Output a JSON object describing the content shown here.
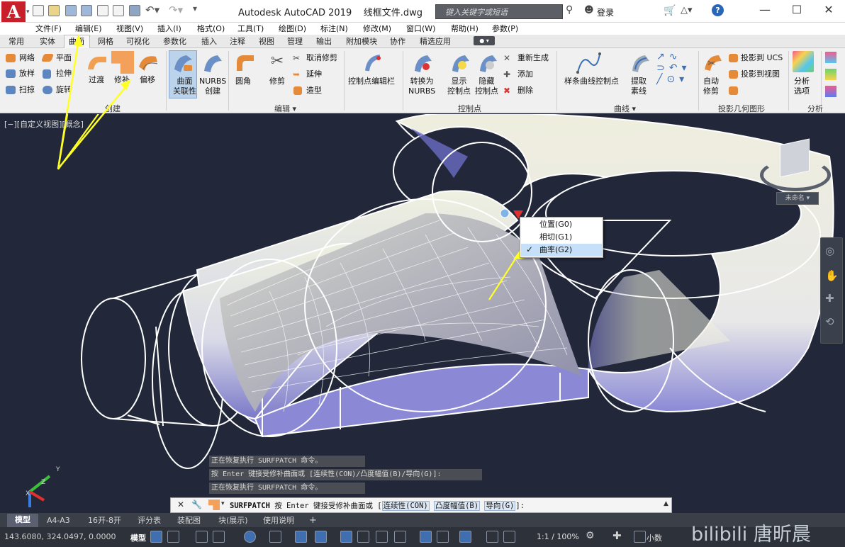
{
  "app": {
    "logo_letter": "A",
    "title": "Autodesk AutoCAD 2019",
    "file": "线框文件.dwg",
    "search_placeholder": "键入关键字或短语",
    "login_label": "登录",
    "help_label": "?"
  },
  "window_controls": {
    "minimize": "—",
    "maximize": "☐",
    "close": "✕"
  },
  "menus": [
    "文件(F)",
    "编辑(E)",
    "视图(V)",
    "插入(I)",
    "格式(O)",
    "工具(T)",
    "绘图(D)",
    "标注(N)",
    "修改(M)",
    "窗口(W)",
    "帮助(H)",
    "参数(P)"
  ],
  "ribbon_tabs": [
    "常用",
    "实体",
    "曲面",
    "网格",
    "可视化",
    "参数化",
    "插入",
    "注释",
    "视图",
    "管理",
    "输出",
    "附加模块",
    "协作",
    "精选应用"
  ],
  "active_tab": "曲面",
  "ribbon": {
    "create_small": [
      "网络",
      "放样",
      "扫掠",
      "平面",
      "拉伸",
      "旋转"
    ],
    "create_large": [
      "过渡",
      "修补",
      "偏移"
    ],
    "assoc_1": "曲面",
    "assoc_2": "关联性",
    "nurbs_1": "NURBS",
    "nurbs_2": "创建",
    "fillet": "圆角",
    "trim": "修剪",
    "edit_small": [
      "取消修剪",
      "延伸",
      "造型"
    ],
    "cv_editbar": "控制点编辑栏",
    "to_nurbs_1": "转换为",
    "to_nurbs_2": "NURBS",
    "show_cv_1": "显示",
    "show_cv_2": "控制点",
    "hide_cv_1": "隐藏",
    "hide_cv_2": "控制点",
    "cv_small": [
      "重新生成",
      "添加",
      "删除"
    ],
    "spline_cv": "样条曲线控制点",
    "extract_1": "提取",
    "extract_2": "素线",
    "auto_trim_1": "自动",
    "auto_trim_2": "修剪",
    "proj_small": [
      "投影到 UCS",
      "投影到视图"
    ],
    "analysis_1": "分析",
    "analysis_2": "选项"
  },
  "panels": [
    "创建",
    "编辑 ▾",
    "控制点",
    "曲线 ▾",
    "投影几何图形",
    "分析"
  ],
  "viewport_label": "[−][自定义视图][概念]",
  "viewcube_label": "未命名 ▾",
  "context_menu": {
    "items": [
      "位置(G0)",
      "相切(G1)",
      "曲率(G2)"
    ],
    "checked": "✓"
  },
  "command_history": [
    "正在恢复执行 SURFPATCH 命令。",
    "按 Enter 键接受修补曲面或 [连续性(CON)/凸度幅值(B)/导向(G)]:",
    "正在恢复执行 SURFPATCH 命令。"
  ],
  "command_line": {
    "cmd": "SURFPATCH",
    "text": "按 Enter 键接受修补曲面或 [",
    "opt1": "连续性(CON)",
    "opt2": "凸度幅值(B)",
    "opt3": "导向(G)",
    "end": "]:"
  },
  "layout_tabs": [
    "模型",
    "A4-A3",
    "16开-8开",
    "评分表",
    "装配图",
    "块(展示)",
    "使用说明",
    "+"
  ],
  "status": {
    "coordinates": "143.6080, 324.0497, 0.0000",
    "model": "模型",
    "scale": "1:1 / 100%",
    "units": "小数"
  },
  "ucs_axes": {
    "x": "X",
    "y": "Y",
    "z": "Z"
  },
  "watermark": "bilibili 唐昕晨",
  "colors": {
    "accent": "#ffff26",
    "viewport_bg": "#22283a"
  }
}
